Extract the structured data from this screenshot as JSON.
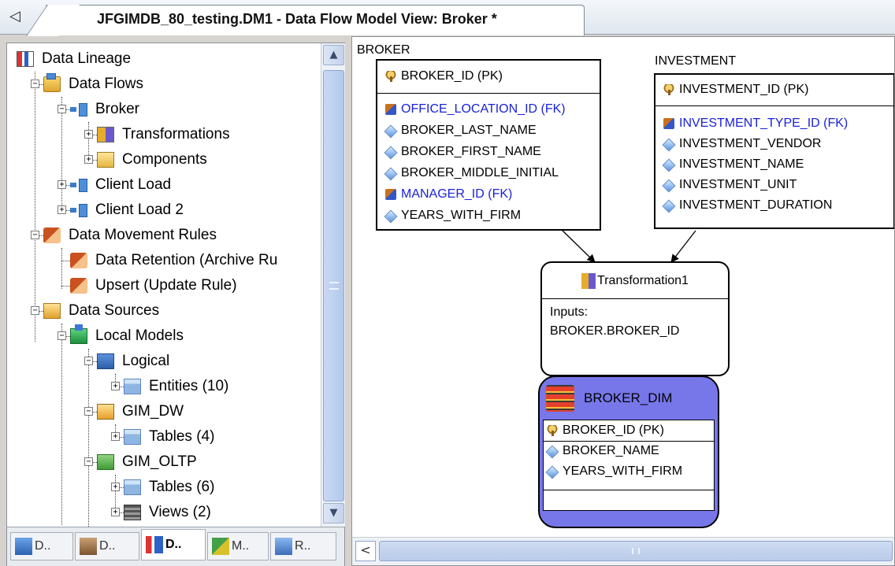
{
  "window": {
    "tab_title": "JFGIMDB_80_testing.DM1 - Data Flow Model View: Broker *",
    "tab_nav_glyph": "◁"
  },
  "tree": {
    "items": [
      {
        "label": "Data Lineage",
        "icon": "data-lineage-icon"
      },
      {
        "label": "Data Flows",
        "icon": "folder-icon"
      },
      {
        "label": "Broker",
        "icon": "data-flow-icon"
      },
      {
        "label": "Transformations",
        "icon": "transformations-icon"
      },
      {
        "label": "Components",
        "icon": "components-icon"
      },
      {
        "label": "Client Load",
        "icon": "data-flow-icon"
      },
      {
        "label": "Client Load 2",
        "icon": "data-flow-icon"
      },
      {
        "label": "Data Movement Rules",
        "icon": "rule-folder-icon"
      },
      {
        "label": "Data Retention (Archive Ru",
        "icon": "rule-icon"
      },
      {
        "label": "Upsert (Update Rule)",
        "icon": "rule-icon"
      },
      {
        "label": "Data Sources",
        "icon": "data-sources-icon"
      },
      {
        "label": "Local Models",
        "icon": "local-models-icon"
      },
      {
        "label": "Logical",
        "icon": "logical-model-icon"
      },
      {
        "label": "Entities (10)",
        "icon": "entities-icon"
      },
      {
        "label": "GIM_DW",
        "icon": "physical-model-icon"
      },
      {
        "label": "Tables (4)",
        "icon": "tables-icon"
      },
      {
        "label": "GIM_OLTP",
        "icon": "physical-model-icon"
      },
      {
        "label": "Tables (6)",
        "icon": "tables-icon"
      },
      {
        "label": "Views (2)",
        "icon": "views-icon"
      }
    ]
  },
  "explorer_tabs": [
    {
      "label": "D..",
      "icon": "data-model-icon",
      "active": false
    },
    {
      "label": "D..",
      "icon": "data-dictionary-icon",
      "active": false
    },
    {
      "label": "D..",
      "icon": "data-lineage-icon",
      "active": true
    },
    {
      "label": "M..",
      "icon": "macros-icon",
      "active": false
    },
    {
      "label": "R..",
      "icon": "repository-icon",
      "active": false
    }
  ],
  "diagram": {
    "broker": {
      "name": "BROKER",
      "pk": "BROKER_ID (PK)",
      "attributes": [
        {
          "text": "OFFICE_LOCATION_ID (FK)",
          "kind": "fk"
        },
        {
          "text": "BROKER_LAST_NAME",
          "kind": "attr"
        },
        {
          "text": "BROKER_FIRST_NAME",
          "kind": "attr"
        },
        {
          "text": "BROKER_MIDDLE_INITIAL",
          "kind": "attr"
        },
        {
          "text": "MANAGER_ID (FK)",
          "kind": "fk"
        },
        {
          "text": "YEARS_WITH_FIRM",
          "kind": "attr"
        }
      ]
    },
    "investment": {
      "name": "INVESTMENT",
      "pk": "INVESTMENT_ID (PK)",
      "attributes": [
        {
          "text": "INVESTMENT_TYPE_ID (FK)",
          "kind": "fk"
        },
        {
          "text": "INVESTMENT_VENDOR",
          "kind": "attr"
        },
        {
          "text": "INVESTMENT_NAME",
          "kind": "attr"
        },
        {
          "text": "INVESTMENT_UNIT",
          "kind": "attr"
        },
        {
          "text": "INVESTMENT_DURATION",
          "kind": "attr"
        }
      ]
    },
    "transformation": {
      "name": "Transformation1",
      "inputs_label": "Inputs:",
      "input": "BROKER.BROKER_ID"
    },
    "broker_dim": {
      "name": "BROKER_DIM",
      "pk": "BROKER_ID (PK)",
      "attributes": [
        "BROKER_NAME",
        "YEARS_WITH_FIRM"
      ]
    },
    "scroll_left_glyph": "<"
  },
  "colors": {
    "fk_text": "#1a22d9",
    "dim_fill": "#7777ea"
  }
}
